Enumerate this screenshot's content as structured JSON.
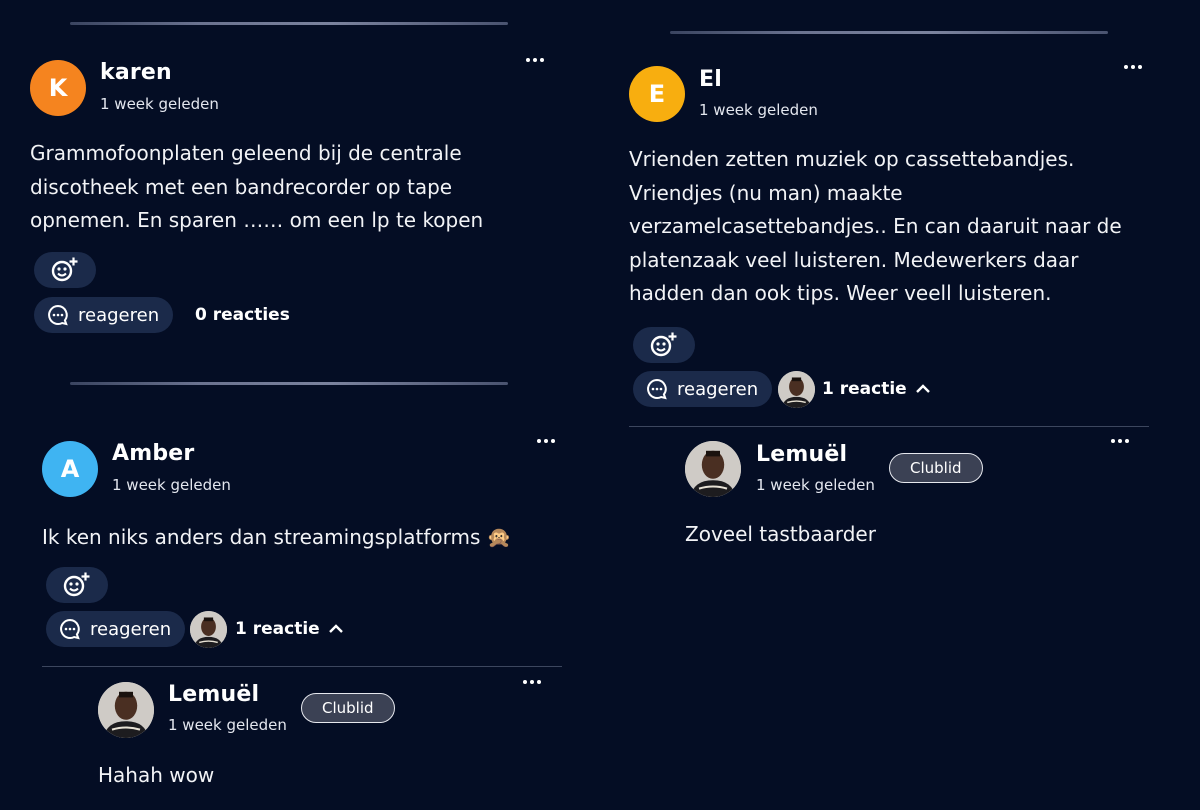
{
  "colors": {
    "background": "#040d24",
    "button_bg": "#1b2a4a",
    "badge_bg": "#3b4154"
  },
  "posts": [
    {
      "author": "karen",
      "initial": "K",
      "avatar_color": "#f5841f",
      "time": "1 week geleden",
      "text": "Grammofoonplaten geleend bij de centrale discotheek met een bandrecorder op tape opnemen. En sparen …… om een lp te kopen",
      "reply_label": "reageren",
      "reactions": "0 reacties"
    },
    {
      "author": "Amber",
      "initial": "A",
      "avatar_color": "#3fb4f2",
      "time": "1 week geleden",
      "text": "Ik ken niks anders dan streamingsplatforms 🙊",
      "reply_label": "reageren",
      "reactions": "1 reactie",
      "reply": {
        "author": "Lemuël",
        "badge": "Clublid",
        "time": "1 week geleden",
        "text": "Hahah wow"
      }
    },
    {
      "author": "El",
      "initial": "E",
      "avatar_color": "#f8ae0f",
      "time": "1 week geleden",
      "text": "Vrienden zetten muziek op cassettebandjes. Vriendjes (nu man) maakte verzamelcasettebandjes.. En can daaruit naar de platenzaak veel luisteren. Medewerkers daar hadden dan ook tips. Weer veell luisteren.",
      "reply_label": "reageren",
      "reactions": "1 reactie",
      "reply": {
        "author": "Lemuël",
        "badge": "Clublid",
        "time": "1 week geleden",
        "text": "Zoveel tastbaarder"
      }
    }
  ],
  "icons": {
    "more": "more-dots-icon",
    "add_reaction": "add-reaction-icon",
    "comment": "comment-bubble-icon",
    "collapse": "chevron-up-icon"
  }
}
